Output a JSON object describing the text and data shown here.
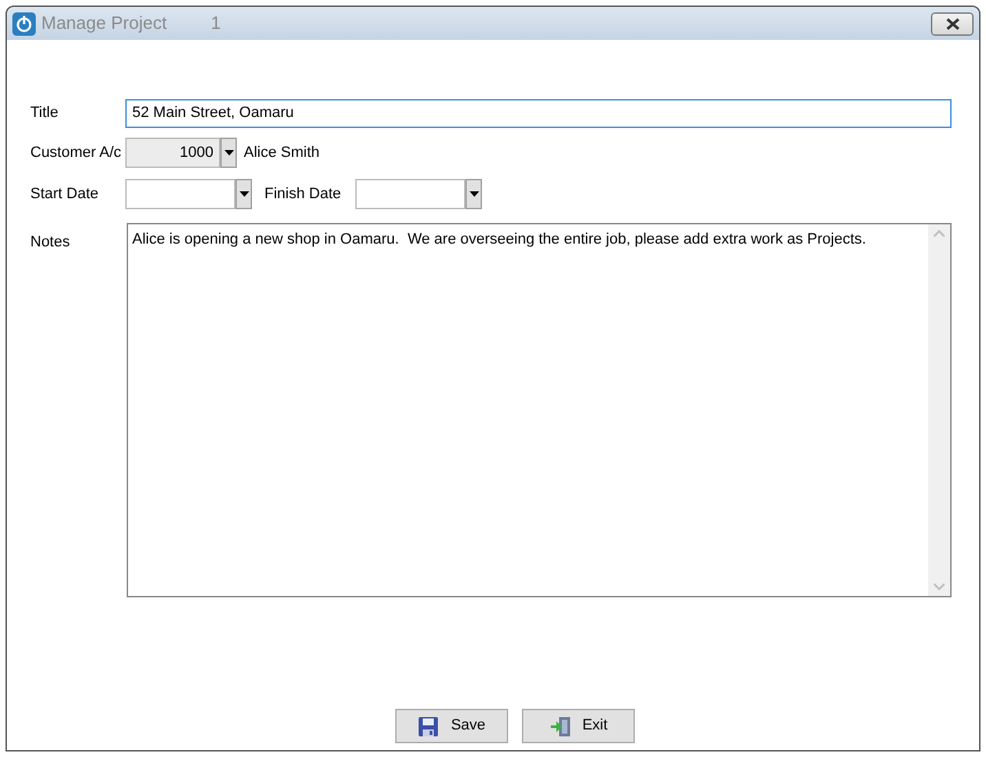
{
  "window": {
    "title": "Manage Project",
    "number": "1"
  },
  "form": {
    "title": {
      "label": "Title",
      "value": "52 Main Street, Oamaru"
    },
    "customer": {
      "label": "Customer A/c",
      "value": "1000",
      "name": "Alice Smith"
    },
    "start_date": {
      "label": "Start Date"
    },
    "finish_date": {
      "label": "Finish Date"
    },
    "notes": {
      "label": "Notes",
      "value": "Alice is opening a new shop in Oamaru.  We are overseeing the entire job, please add extra work as Projects."
    }
  },
  "buttons": [
    {
      "kind": "save",
      "label": "Save"
    },
    {
      "kind": "exit",
      "label": "Exit"
    }
  ]
}
